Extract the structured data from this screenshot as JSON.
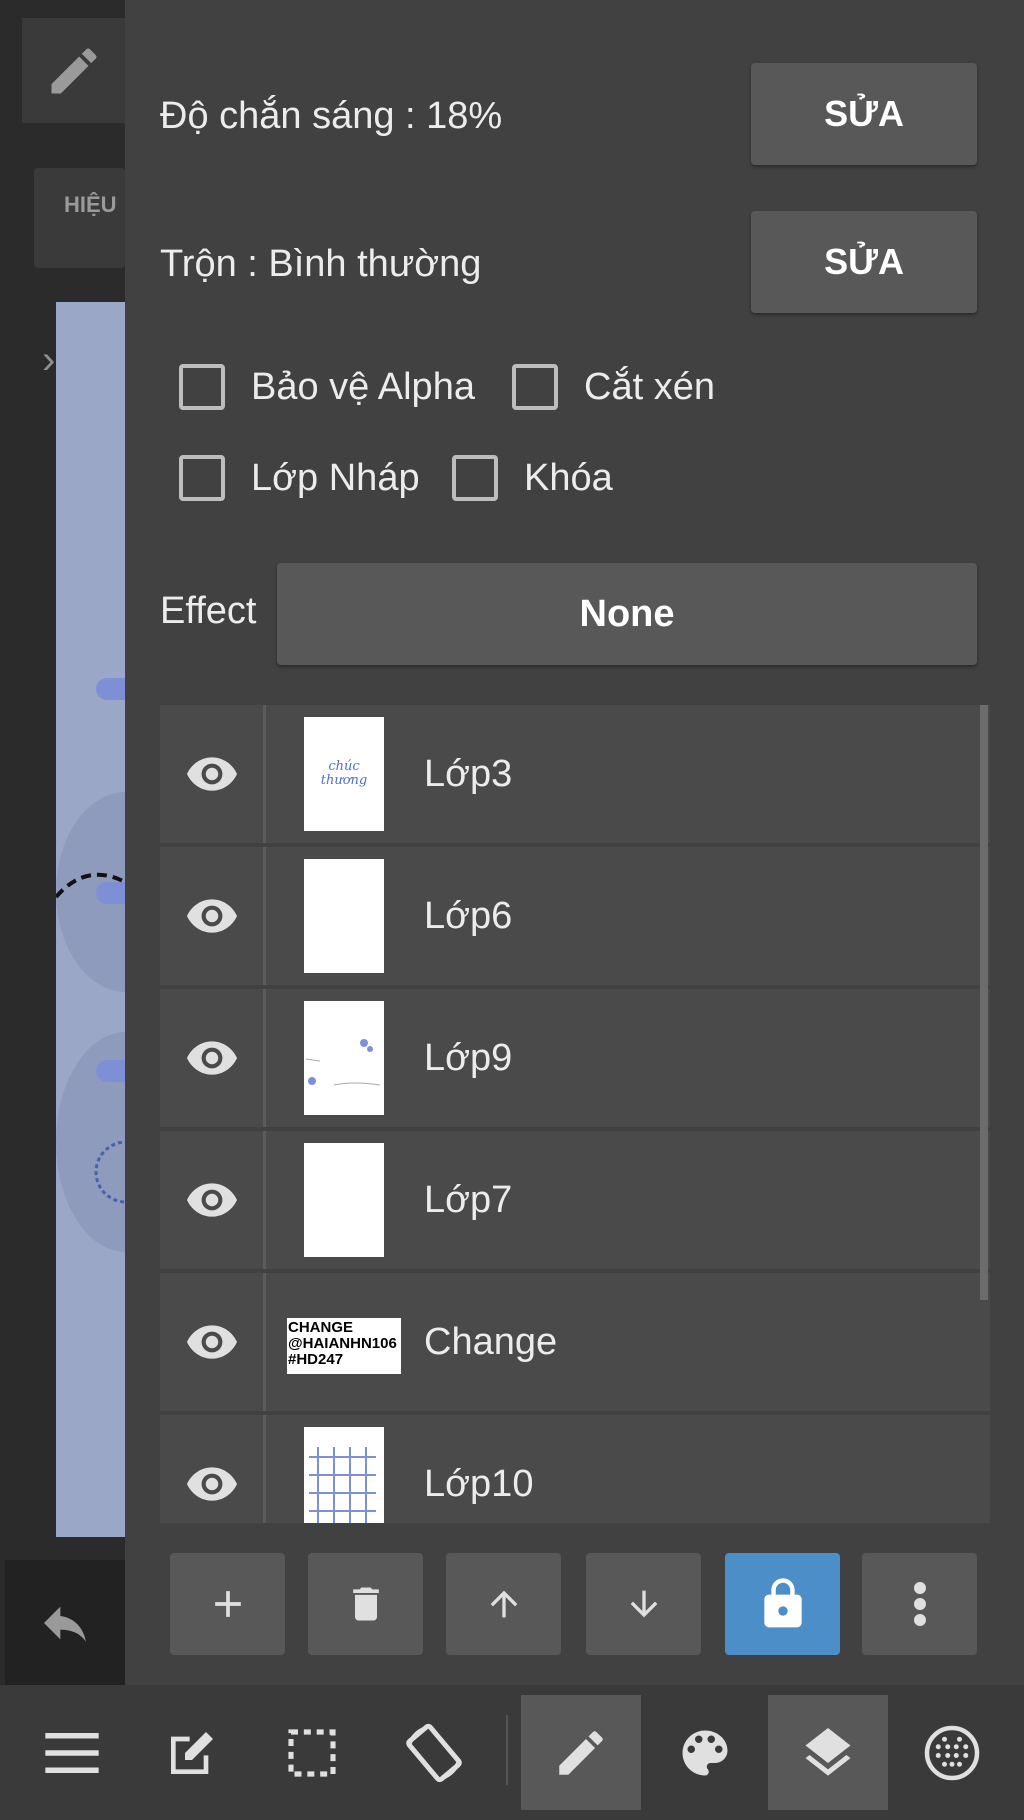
{
  "left": {
    "tab_label": "HIỆU"
  },
  "opacity": {
    "label": "Độ chắn sáng : 18%",
    "edit_label": "SỬA"
  },
  "blend": {
    "label": "Trộn : Bình thường",
    "edit_label": "SỬA"
  },
  "checkboxes": {
    "protect_alpha": "Bảo vệ Alpha",
    "clipping": "Cắt xén",
    "draft_layer": "Lớp Nháp",
    "lock": "Khóa"
  },
  "effect": {
    "label": "Effect",
    "value": "None"
  },
  "layers": [
    {
      "name": "Lớp3",
      "thumb_text": "chúc thương"
    },
    {
      "name": "Lớp6"
    },
    {
      "name": "Lớp9"
    },
    {
      "name": "Lớp7"
    },
    {
      "name": "Change",
      "thumb_text": "CHANGE\n@HAIANHN106\n#HD247"
    },
    {
      "name": "Lớp10"
    }
  ],
  "colors": {
    "panel": "#414141",
    "button": "#585858",
    "accent": "#4b8ec8",
    "text": "#ececec"
  },
  "toolbar_icons": [
    "add-icon",
    "trash-icon",
    "arrow-up-icon",
    "arrow-down-icon",
    "lock-icon",
    "more-vertical-icon"
  ],
  "bottom_icons": [
    "menu-icon",
    "edit-icon",
    "selection-icon",
    "rotate-icon",
    "pencil-icon",
    "palette-icon",
    "layers-icon",
    "grid-icon"
  ]
}
